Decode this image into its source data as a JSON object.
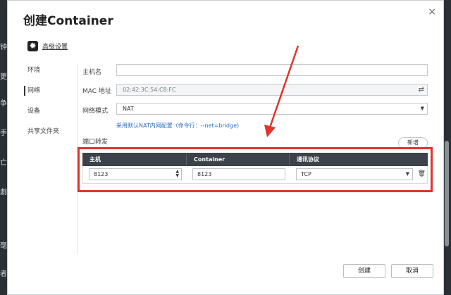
{
  "background": {
    "left_glyphs": [
      "钟",
      "更",
      "争",
      "手",
      "亡",
      "劇",
      "毫",
      "者"
    ]
  },
  "dialog": {
    "title": "创建Container",
    "close_glyph": "×",
    "advanced_label": "高级设置"
  },
  "nav": {
    "items": [
      "环境",
      "网络",
      "设备",
      "共享文件夹"
    ],
    "active_index": 1
  },
  "form": {
    "hostname_label": "主机名",
    "hostname_value": "",
    "mac_label": "MAC 地址",
    "mac_value": "02:42:3C:54:C8:FC",
    "network_mode_label": "网络模式",
    "network_mode_value": "NAT",
    "nat_link": "采用默认NAT内网配置（命令行：--net=bridge)",
    "port_forward_label": "端口转发",
    "new_button": "新增"
  },
  "port_table": {
    "headers": [
      "主机",
      "Container",
      "通讯协议"
    ],
    "rows": [
      {
        "host": "8123",
        "container": "8123",
        "protocol": "TCP"
      }
    ]
  },
  "footer": {
    "create": "创建",
    "cancel": "取消"
  },
  "colors": {
    "highlight": "#e0342d",
    "header_bg": "#3b4249",
    "link": "#2a6fc4"
  }
}
